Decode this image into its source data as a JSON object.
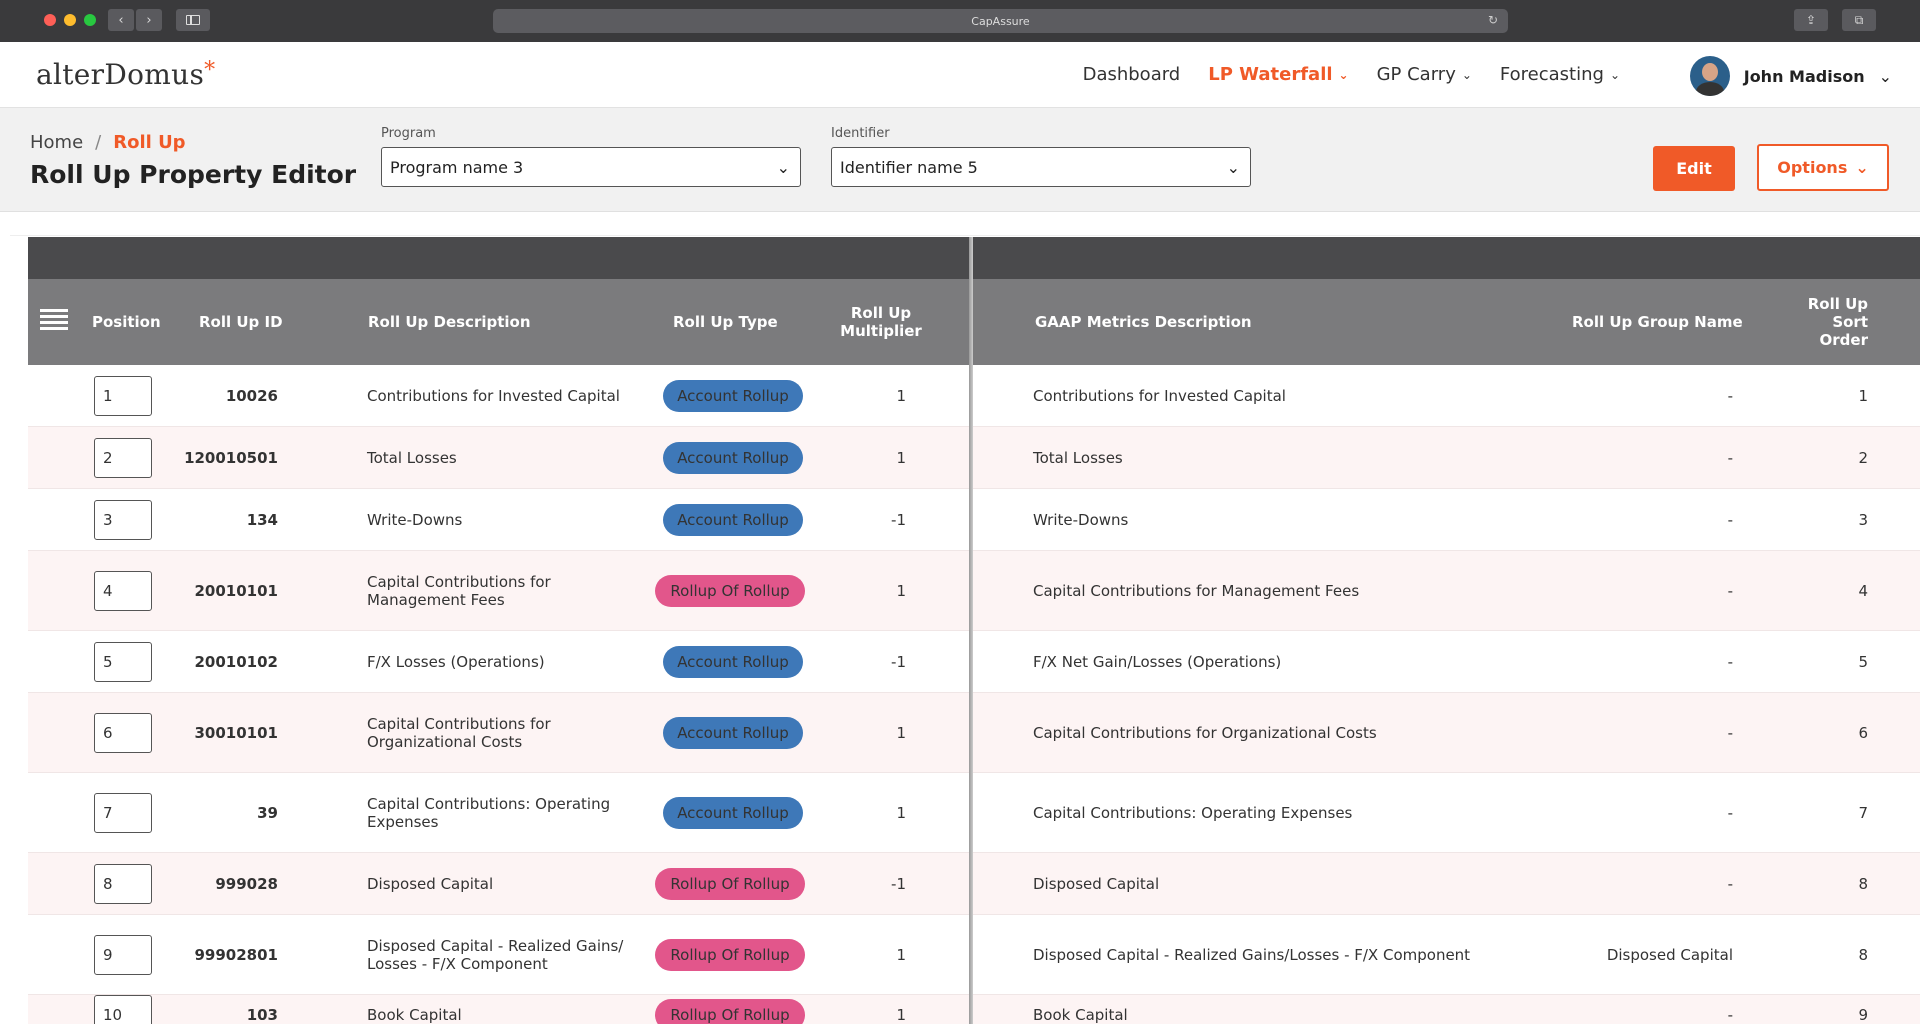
{
  "browser": {
    "url_title": "CapAssure"
  },
  "header": {
    "logo_text": "alterDomus",
    "logo_star": "*",
    "nav": [
      {
        "label": "Dashboard",
        "has_menu": false,
        "active": false
      },
      {
        "label": "LP Waterfall",
        "has_menu": true,
        "active": true
      },
      {
        "label": "GP Carry",
        "has_menu": true,
        "active": false
      },
      {
        "label": "Forecasting",
        "has_menu": true,
        "active": false
      }
    ],
    "user_name": "John Madison"
  },
  "subheader": {
    "breadcrumb_home": "Home",
    "breadcrumb_sep": "/",
    "breadcrumb_current": "Roll Up",
    "page_title": "Roll Up Property Editor",
    "program_label": "Program",
    "program_value": "Program name 3",
    "identifier_label": "Identifier",
    "identifier_value": "Identifier name 5",
    "edit_label": "Edit",
    "options_label": "Options"
  },
  "table": {
    "headers": {
      "position": "Position",
      "rollup_id": "Roll Up ID",
      "description": "Roll Up Description",
      "type": "Roll Up Type",
      "multiplier_1": "Roll Up",
      "multiplier_2": "Multiplier",
      "gaap": "GAAP Metrics Description",
      "group": "Roll Up Group Name",
      "sort_1": "Roll Up Sort",
      "sort_2": "Order"
    },
    "rows": [
      {
        "pos": "1",
        "id": "10026",
        "desc": "Contributions for Invested Capital",
        "type": "Account Rollup",
        "kind": "acct",
        "mult": "1",
        "gaap": "Contributions for Invested Capital",
        "group": "-",
        "sort": "1"
      },
      {
        "pos": "2",
        "id": "120010501",
        "desc": "Total Losses",
        "type": "Account Rollup",
        "kind": "acct",
        "mult": "1",
        "gaap": "Total Losses",
        "group": "-",
        "sort": "2"
      },
      {
        "pos": "3",
        "id": "134",
        "desc": "Write-Downs",
        "type": "Account Rollup",
        "kind": "acct",
        "mult": "-1",
        "gaap": "Write-Downs",
        "group": "-",
        "sort": "3"
      },
      {
        "pos": "4",
        "id": "20010101",
        "desc": "Capital Contributions for Management  Fees",
        "type": "Rollup Of Rollup",
        "kind": "rr",
        "mult": "1",
        "gaap": "Capital Contributions for Management Fees",
        "group": "-",
        "sort": "4"
      },
      {
        "pos": "5",
        "id": "20010102",
        "desc": "F/X Losses (Operations)",
        "type": "Account Rollup",
        "kind": "acct",
        "mult": "-1",
        "gaap": "F/X Net Gain/Losses (Operations)",
        "group": "-",
        "sort": "5"
      },
      {
        "pos": "6",
        "id": "30010101",
        "desc": "Capital Contributions for Organizational  Costs",
        "type": "Account Rollup",
        "kind": "acct",
        "mult": "1",
        "gaap": "Capital Contributions for Organizational Costs",
        "group": "-",
        "sort": "6"
      },
      {
        "pos": "7",
        "id": "39",
        "desc": "Capital Contributions: Operating Expenses",
        "type": "Account Rollup",
        "kind": "acct",
        "mult": "1",
        "gaap": "Capital Contributions: Operating Expenses",
        "group": "-",
        "sort": "7"
      },
      {
        "pos": "8",
        "id": "999028",
        "desc": "Disposed Capital",
        "type": "Rollup Of Rollup",
        "kind": "rr",
        "mult": "-1",
        "gaap": "Disposed Capital",
        "group": "-",
        "sort": "8"
      },
      {
        "pos": "9",
        "id": "99902801",
        "desc": "Disposed Capital - Realized Gains/ Losses - F/X Component",
        "type": "Rollup Of Rollup",
        "kind": "rr",
        "mult": "1",
        "gaap": "Disposed Capital - Realized Gains/Losses - F/X Component",
        "group": "Disposed Capital",
        "sort": "8"
      },
      {
        "pos": "10",
        "id": "103",
        "desc": "Book Capital",
        "type": "Rollup Of Rollup",
        "kind": "rr",
        "mult": "1",
        "gaap": "Book Capital",
        "group": "-",
        "sort": "9"
      }
    ]
  }
}
